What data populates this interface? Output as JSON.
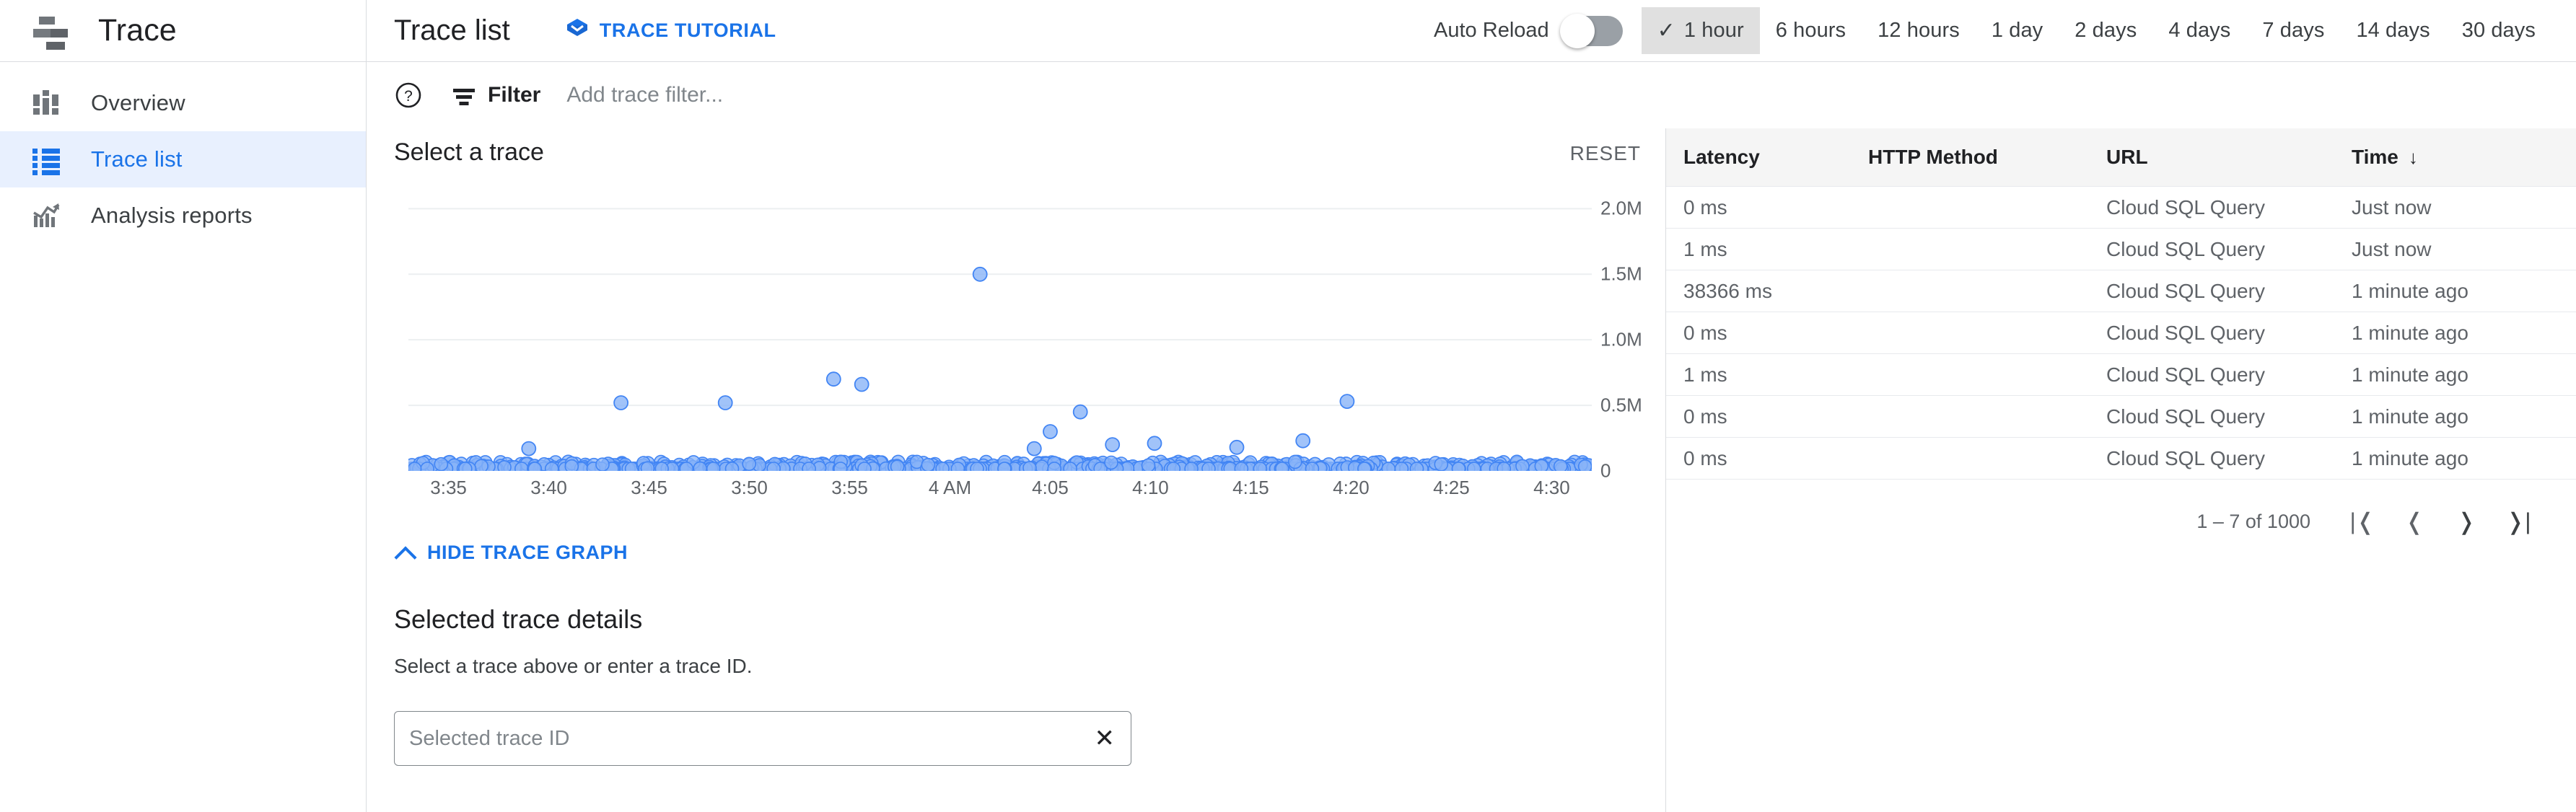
{
  "sidebar": {
    "brand": {
      "title": "Trace",
      "icon": "trace-logo-icon",
      "menu_icon": "hamburger-icon"
    },
    "items": [
      {
        "label": "Overview",
        "icon": "overview-dashboard-icon",
        "active": false
      },
      {
        "label": "Trace list",
        "icon": "list-icon",
        "active": true
      },
      {
        "label": "Analysis reports",
        "icon": "analytics-chart-icon",
        "active": false
      }
    ]
  },
  "topbar": {
    "page_title": "Trace list",
    "tutorial_label": "TRACE TUTORIAL",
    "tutorial_icon": "tutorial-diamond-icon",
    "auto_reload_label": "Auto Reload",
    "auto_reload_on": false,
    "ranges": [
      {
        "label": "1 hour",
        "selected": true
      },
      {
        "label": "6 hours",
        "selected": false
      },
      {
        "label": "12 hours",
        "selected": false
      },
      {
        "label": "1 day",
        "selected": false
      },
      {
        "label": "2 days",
        "selected": false
      },
      {
        "label": "4 days",
        "selected": false
      },
      {
        "label": "7 days",
        "selected": false
      },
      {
        "label": "14 days",
        "selected": false
      },
      {
        "label": "30 days",
        "selected": false
      }
    ],
    "check_glyph": "✓"
  },
  "filterbar": {
    "help_icon": "help-circle-icon",
    "filter_icon": "filter-lines-icon",
    "filter_label": "Filter",
    "filter_placeholder": "Add trace filter...",
    "filter_value": ""
  },
  "chart_panel": {
    "title": "Select a trace",
    "reset_label": "RESET"
  },
  "chart_data": {
    "type": "scatter",
    "title": "Select a trace",
    "xlabel": "",
    "ylabel": "",
    "grid": true,
    "legend": null,
    "ylim": [
      0,
      2200000
    ],
    "yticks": [
      0,
      500000,
      1000000,
      1500000,
      2000000
    ],
    "ytick_labels": [
      "0",
      "0.5M",
      "1.0M",
      "1.5M",
      "2.0M"
    ],
    "xtick_labels": [
      "3:35",
      "3:40",
      "3:45",
      "3:50",
      "3:55",
      "4 AM",
      "4:05",
      "4:10",
      "4:15",
      "4:20",
      "4:25",
      "4:30"
    ],
    "xlim_minutes": [
      213,
      272
    ],
    "point_color": "#8ab4f8",
    "point_stroke": "#4285f4",
    "outliers": [
      {
        "x_min": 241.5,
        "y": 1500000
      },
      {
        "x_min": 234.2,
        "y": 700000
      },
      {
        "x_min": 235.6,
        "y": 660000
      },
      {
        "x_min": 228.8,
        "y": 520000
      },
      {
        "x_min": 223.6,
        "y": 520000
      },
      {
        "x_min": 246.5,
        "y": 450000
      },
      {
        "x_min": 259.8,
        "y": 530000
      },
      {
        "x_min": 245.0,
        "y": 300000
      },
      {
        "x_min": 257.6,
        "y": 230000
      },
      {
        "x_min": 250.2,
        "y": 210000
      },
      {
        "x_min": 248.1,
        "y": 200000
      },
      {
        "x_min": 219.0,
        "y": 170000
      },
      {
        "x_min": 254.3,
        "y": 180000
      },
      {
        "x_min": 244.2,
        "y": 170000
      }
    ],
    "baseline_note": "Dense cluster of low-latency traces forms a solid band at y=0 across the full time range"
  },
  "hide_graph": {
    "label": "HIDE TRACE GRAPH",
    "icon": "chevron-up-icon"
  },
  "details": {
    "title": "Selected trace details",
    "subtitle": "Select a trace above or enter a trace ID.",
    "trace_id_placeholder": "Selected trace ID",
    "trace_id_value": "",
    "clear_icon": "close-x-icon",
    "clear_glyph": "✕"
  },
  "table": {
    "columns": [
      "Latency",
      "HTTP Method",
      "URL",
      "Time"
    ],
    "sort_column": "Time",
    "sort_glyph": "↓",
    "rows": [
      {
        "latency": "0 ms",
        "method": "",
        "url": "Cloud SQL Query",
        "time": "Just now"
      },
      {
        "latency": "1 ms",
        "method": "",
        "url": "Cloud SQL Query",
        "time": "Just now"
      },
      {
        "latency": "38366 ms",
        "method": "",
        "url": "Cloud SQL Query",
        "time": "1 minute ago"
      },
      {
        "latency": "0 ms",
        "method": "",
        "url": "Cloud SQL Query",
        "time": "1 minute ago"
      },
      {
        "latency": "1 ms",
        "method": "",
        "url": "Cloud SQL Query",
        "time": "1 minute ago"
      },
      {
        "latency": "0 ms",
        "method": "",
        "url": "Cloud SQL Query",
        "time": "1 minute ago"
      },
      {
        "latency": "0 ms",
        "method": "",
        "url": "Cloud SQL Query",
        "time": "1 minute ago"
      }
    ],
    "pagination": {
      "count_label": "1 – 7 of 1000",
      "first_glyph": "|❬",
      "prev_glyph": "❬",
      "next_glyph": "❭",
      "last_glyph": "❭|"
    }
  },
  "colors": {
    "accent": "#1a73e8",
    "accent_bg": "#e8f0fe",
    "point_fill": "#8ab4f8",
    "point_stroke": "#4285f4",
    "border": "#dadce0",
    "header_bg": "#f5f5f5",
    "muted_text": "#5f6368"
  }
}
